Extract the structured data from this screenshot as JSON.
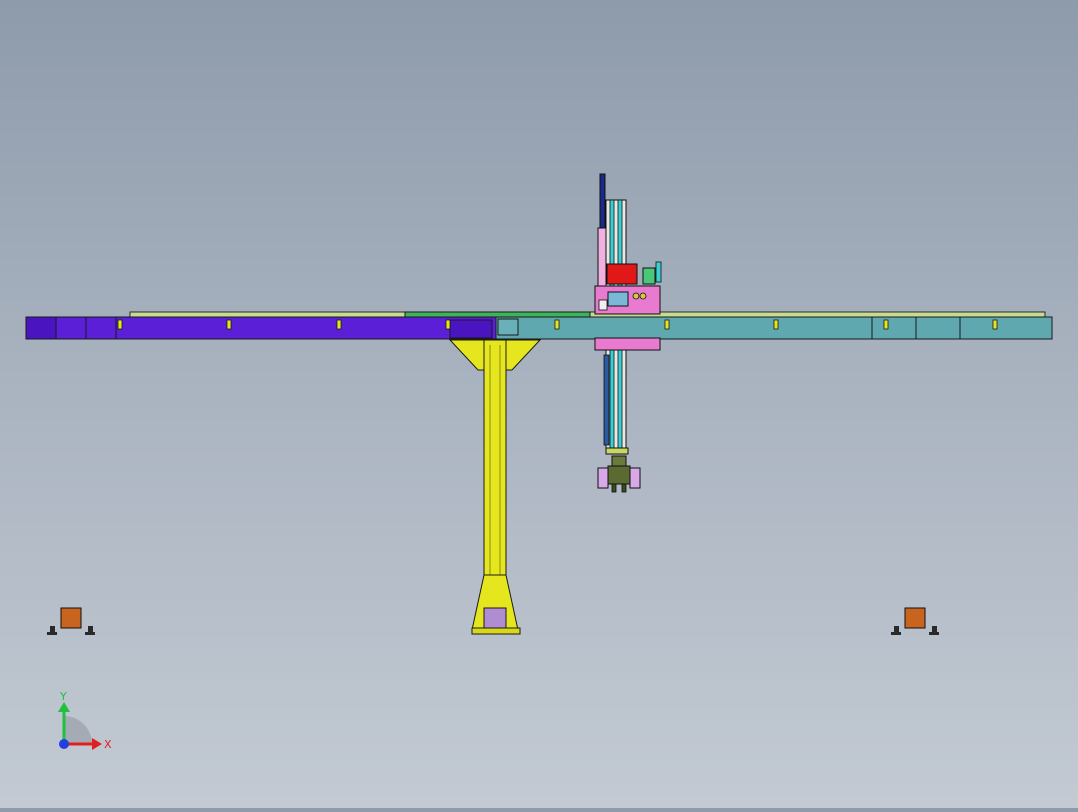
{
  "triad": {
    "x_label": "X",
    "y_label": "Y",
    "x_color": "#e02020",
    "y_color": "#20c040",
    "z_color": "#2040e0"
  },
  "colors": {
    "background_top": "#8e9bab",
    "background_bottom": "#c3cad3",
    "beam_left": "#5a1fd6",
    "beam_right": "#5fa8b0",
    "rail_top": "#c8dc90",
    "rail_mid": "#3cb45a",
    "pillar": "#e6e61e",
    "pillar_base": "#b08cd0",
    "carriage": "#e87ad0",
    "mast": "#38d0d0",
    "motor": "#e01818",
    "gripper": "#d8a8e8",
    "foot_block": "#c8641e"
  }
}
